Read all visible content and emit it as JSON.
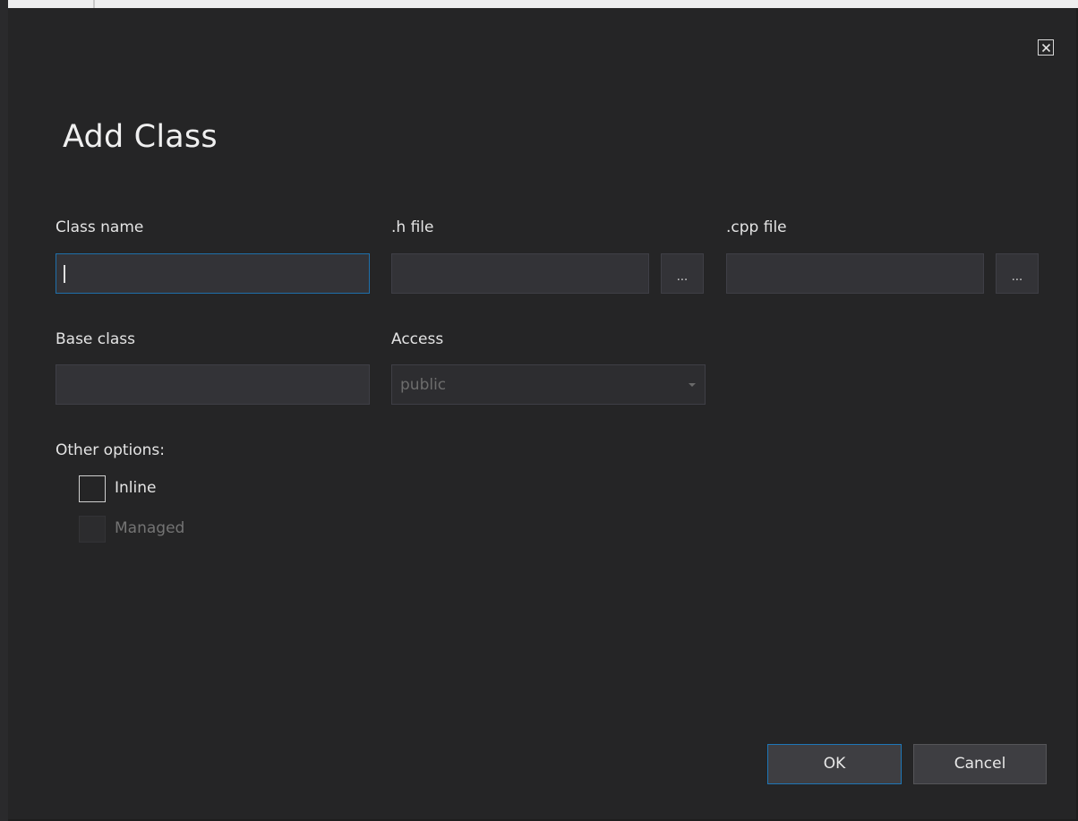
{
  "dialog": {
    "title": "Add Class",
    "close_icon": "close-icon"
  },
  "fields": {
    "class_name": {
      "label": "Class name",
      "value": ""
    },
    "h_file": {
      "label": ".h file",
      "value": "",
      "browse_label": "..."
    },
    "cpp_file": {
      "label": ".cpp file",
      "value": "",
      "browse_label": "..."
    },
    "base_class": {
      "label": "Base class",
      "value": ""
    },
    "access": {
      "label": "Access",
      "selected": "public"
    }
  },
  "options": {
    "heading": "Other options:",
    "inline": {
      "label": "Inline",
      "checked": false
    },
    "managed": {
      "label": "Managed",
      "checked": false,
      "enabled": false
    }
  },
  "buttons": {
    "ok": "OK",
    "cancel": "Cancel"
  },
  "colors": {
    "background": "#252526",
    "input_bg": "#333337",
    "focus_border": "#1f6faa",
    "text": "#e4e4e4",
    "disabled_text": "#747474"
  }
}
